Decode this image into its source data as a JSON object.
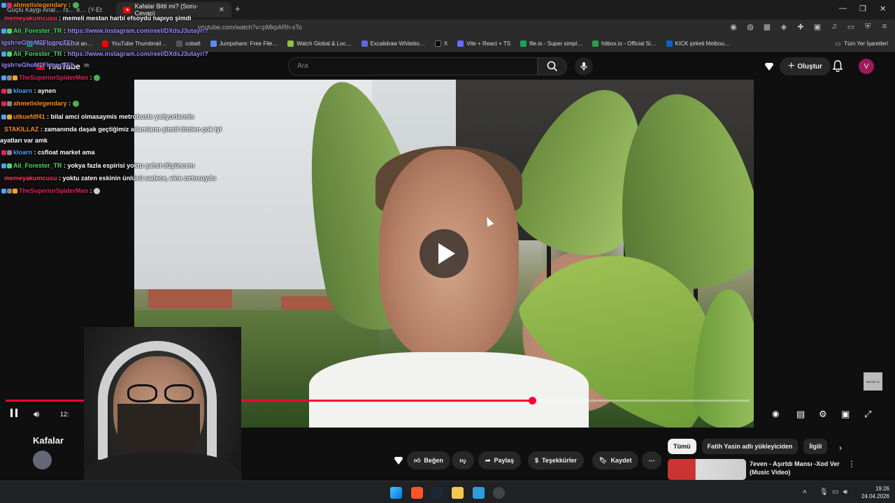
{
  "browser": {
    "tabs": [
      {
        "label": "Güçlü Kaygı Anal… rs… e… (Y-Et",
        "active": false
      },
      {
        "label": "Kafalar Bitti mi? (Soru-Cevap)",
        "active": true
      }
    ],
    "new_tab": "+",
    "url": "youtube.com/watch?v=pMkpARh-sTo",
    "bookmarks": [
      {
        "label": "The best ChatBot an…",
        "color": "#10a37f"
      },
      {
        "label": "YouTube Thumbnail…",
        "color": "#ff0000"
      },
      {
        "label": "cobalt",
        "color": "#555"
      },
      {
        "label": "Jumpshare: Free File…",
        "color": "#5b8def"
      },
      {
        "label": "Watch Global & Loc…",
        "color": "#8bc34a"
      },
      {
        "label": "Excalidraw Whitebo…",
        "color": "#6965db"
      },
      {
        "label": "X",
        "color": "#000"
      },
      {
        "label": "Vite + React + TS",
        "color": "#646cff"
      },
      {
        "label": "file.io - Super simpl…",
        "color": "#1aa260"
      },
      {
        "label": "hitbox.io - Official Si…",
        "color": "#2a9d4a"
      },
      {
        "label": "KICK şirketi Melbou…",
        "color": "#0a66c2"
      }
    ],
    "all_bookmarks": "Tüm Yer İşaretleri"
  },
  "youtube": {
    "logo_text": "YouTube",
    "logo_suffix": "TR",
    "search_placeholder": "Ara",
    "create_label": "Oluştur",
    "avatar_letter": "V",
    "video_title": "Kafalar",
    "actions": {
      "like": "Beğen",
      "share": "Paylaş",
      "thanks": "Teşekkürler",
      "save": "Kaydet"
    },
    "chips": [
      "Tümü",
      "Fatih Yasin adlı yükleyiciden",
      "İlgili"
    ],
    "recommendation": {
      "title": "7even - Aşırtdı Mansı -Xod Ver (Music Video)"
    },
    "player": {
      "progress_fraction": 0.708,
      "time_partial": "12:",
      "subscribe_badge": "ABONE OL"
    }
  },
  "chat": [
    {
      "user": "ahmetislegendary",
      "user_color": "#ff8c1a",
      "msg": "",
      "emote": true
    },
    {
      "user": "memeyakumcusu",
      "user_color": "#ff3b5c",
      "msg": "memeli mestan harbi efsoydu napıyo şimdi"
    },
    {
      "user": "Ali_Forester_TR",
      "user_color": "#4cd964",
      "msg": "https://www.instagram.com/reel/DXdsJ3utayr/?",
      "link": true
    },
    {
      "user": "",
      "user_color": "#9b8cff",
      "msg": "igsh=eGhoM2FlcgncTFh",
      "link": true
    },
    {
      "user": "Ali_Forester_TR",
      "user_color": "#4cd964",
      "msg": "https://www.instagram.com/reel/DXdsJ3utayr/?",
      "link": true
    },
    {
      "user": "",
      "user_color": "#9b8cff",
      "msg": "igsh=eGhoM2FlcgncTFh",
      "link": true
    },
    {
      "user": "TheSuperiorSpiderMan",
      "user_color": "#e0245e",
      "msg": "",
      "emote": true
    },
    {
      "user": "kloarn",
      "user_color": "#4aa3ff",
      "msg": "aynen"
    },
    {
      "user": "ahmetislegendary",
      "user_color": "#ff8c1a",
      "msg": "",
      "emote": true
    },
    {
      "user": "utkuefdf41",
      "user_color": "#ff8c1a",
      "msg": "bilal amci olmasaymis metrobuste yatiyorlarmis"
    },
    {
      "user": "STAKILLAZ",
      "user_color": "#ff8c1a",
      "msg": "zamanında daşak geçtiğimiz adamların şimdi bizden çok iyi"
    },
    {
      "user": "",
      "user_color": "#fff",
      "msg": "ayatları var amk"
    },
    {
      "user": "kloarn",
      "user_color": "#4aa3ff",
      "msg": "csfloat market ama"
    },
    {
      "user": "Ali_Forester_TR",
      "user_color": "#4cd964",
      "msg": "yokya fazla espirisi yoktu şahsi düşüncem"
    },
    {
      "user": "memeyakumcusu",
      "user_color": "#ff3b5c",
      "msg": "yoktu zaten eskinin ünlüsü sadece, vine zırtosuydu"
    },
    {
      "user": "TheSuperiorSpiderMan",
      "user_color": "#e0245e",
      "msg": "",
      "emote": true
    }
  ],
  "taskbar": {
    "time": "19:26",
    "date": "24.04.2026"
  },
  "colors": {
    "youtube_red": "#ff0033",
    "bg": "#0f0f0f",
    "chip_bg": "#272727"
  }
}
